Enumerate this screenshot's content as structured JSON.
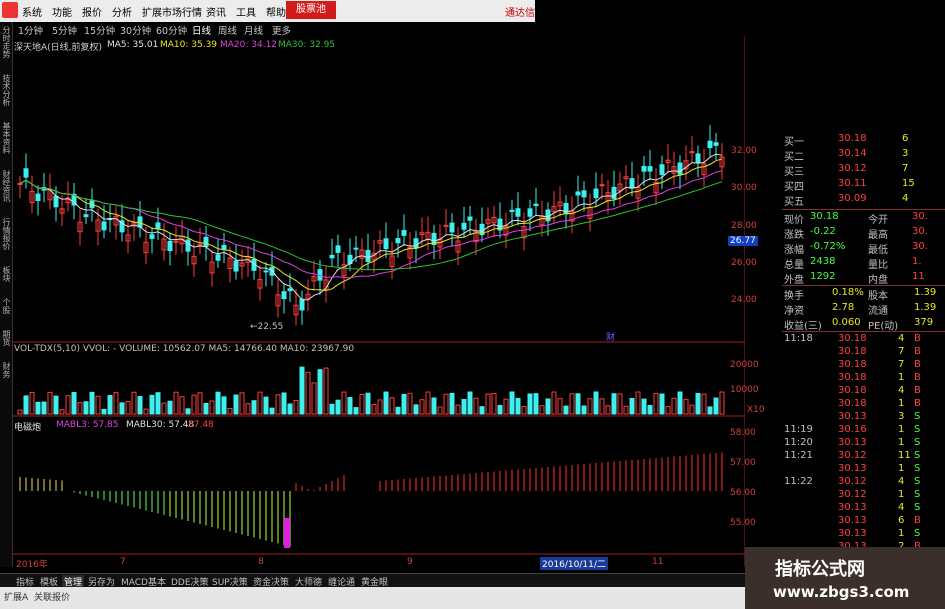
{
  "menu": {
    "items": [
      "系统",
      "功能",
      "报价",
      "分析",
      "扩展市场行情",
      "资讯",
      "工具",
      "帮助"
    ],
    "login_label": "股票池",
    "right_label": "通达信"
  },
  "periods": {
    "items": [
      "1分钟",
      "5分钟",
      "15分钟",
      "30分钟",
      "60分钟",
      "日线",
      "周线",
      "月线",
      "更多"
    ],
    "active": "日线"
  },
  "left_tabs": [
    "分时走势",
    "技术分析",
    "基本资料",
    "财经资讯",
    "行情报价",
    "板块",
    "个股",
    "期货",
    "财务"
  ],
  "main_chart": {
    "title": "深天地A(日线,前复权)",
    "ma5": "MA5: 35.01",
    "ma10": "MA10: 35.39",
    "ma20": "MA20: 34.12",
    "ma30": "MA30: 32.95",
    "y_ticks": [
      "32.00",
      "30.00",
      "28.00",
      "26.00",
      "24.00"
    ],
    "low_label": "←22.55",
    "cursor_price": "26.77",
    "note": "财"
  },
  "vol_chart": {
    "title": "VOL-TDX(5,10)  VVOL: -  VOLUME: 10562.07  MA5: 14766.40  MA10: 23967.90",
    "y_ticks": [
      "20000",
      "10000",
      "X10"
    ]
  },
  "ind_chart": {
    "title": "电磁炮",
    "mabl3": "MABL3: 57.85",
    "mabl30": "MABL30: 57.48",
    "extra": "57.48",
    "y_ticks": [
      "58.00",
      "57.00",
      "56.00",
      "55.00"
    ]
  },
  "x_axis": {
    "labels": [
      "2016年",
      "7",
      "8",
      "9",
      "10",
      "11"
    ],
    "cursor_date": "2016/10/11/二"
  },
  "quote_panel": {
    "bids": [
      {
        "label": "买一",
        "price": "30.18",
        "vol": "6"
      },
      {
        "label": "买二",
        "price": "30.14",
        "vol": "3"
      },
      {
        "label": "买三",
        "price": "30.12",
        "vol": "7"
      },
      {
        "label": "买四",
        "price": "30.11",
        "vol": "15"
      },
      {
        "label": "买五",
        "price": "30.09",
        "vol": "4"
      }
    ],
    "stats": [
      {
        "k1": "现价",
        "v1": "30.18",
        "k2": "今开",
        "v2": "30."
      },
      {
        "k1": "涨跌",
        "v1": "-0.22",
        "k2": "最高",
        "v2": "30."
      },
      {
        "k1": "涨幅",
        "v1": "-0.72%",
        "k2": "最低",
        "v2": "30."
      },
      {
        "k1": "总量",
        "v1": "2438",
        "k2": "量比",
        "v2": "1."
      },
      {
        "k1": "外盘",
        "v1": "1292",
        "k2": "内盘",
        "v2": "11"
      }
    ],
    "stats2": [
      {
        "k1": "换手",
        "v1": "0.18%",
        "k2": "股本",
        "v2": "1.39"
      },
      {
        "k1": "净资",
        "v1": "2.78",
        "k2": "流通",
        "v2": "1.39"
      },
      {
        "k1": "收益(三)",
        "v1": "0.060",
        "k2": "PE(动)",
        "v2": "379"
      }
    ],
    "ticks": [
      {
        "time": "11:18",
        "price": "30.18",
        "vol": "4",
        "side": "B"
      },
      {
        "time": "",
        "price": "30.18",
        "vol": "7",
        "side": "B"
      },
      {
        "time": "",
        "price": "30.18",
        "vol": "7",
        "side": "B"
      },
      {
        "time": "",
        "price": "30.18",
        "vol": "1",
        "side": "B"
      },
      {
        "time": "",
        "price": "30.18",
        "vol": "4",
        "side": "B"
      },
      {
        "time": "",
        "price": "30.18",
        "vol": "1",
        "side": "B"
      },
      {
        "time": "",
        "price": "30.13",
        "vol": "3",
        "side": "S"
      },
      {
        "time": "11:19",
        "price": "30.16",
        "vol": "1",
        "side": "S"
      },
      {
        "time": "11:20",
        "price": "30.13",
        "vol": "1",
        "side": "S"
      },
      {
        "time": "11:21",
        "price": "30.12",
        "vol": "11",
        "side": "S"
      },
      {
        "time": "",
        "price": "30.13",
        "vol": "1",
        "side": "S"
      },
      {
        "time": "11:22",
        "price": "30.12",
        "vol": "4",
        "side": "S"
      },
      {
        "time": "",
        "price": "30.12",
        "vol": "1",
        "side": "S"
      },
      {
        "time": "",
        "price": "30.13",
        "vol": "4",
        "side": "S"
      },
      {
        "time": "",
        "price": "30.13",
        "vol": "6",
        "side": "B"
      },
      {
        "time": "",
        "price": "30.13",
        "vol": "1",
        "side": "S"
      },
      {
        "time": "",
        "price": "30.13",
        "vol": "2",
        "side": "B"
      }
    ]
  },
  "bottom_tabs": [
    "指标",
    "模板",
    "管理",
    "另存为",
    "MACD基本",
    "DDE决策",
    "SUP决策",
    "资金决策",
    "大师德",
    "缠论通",
    "黄金眼"
  ],
  "bottom_active": "管理",
  "sub_tabs": [
    "扩展A",
    "关联报价"
  ],
  "watermark": {
    "line1": "指标公式网",
    "line2": "www.zbgs3.com"
  },
  "colors": {
    "up": "#ff3c3c",
    "down": "#3cf0f0",
    "ma5": "#e0e0e0",
    "ma10": "#e8e820",
    "ma20": "#e040e0",
    "ma30": "#30c030"
  }
}
